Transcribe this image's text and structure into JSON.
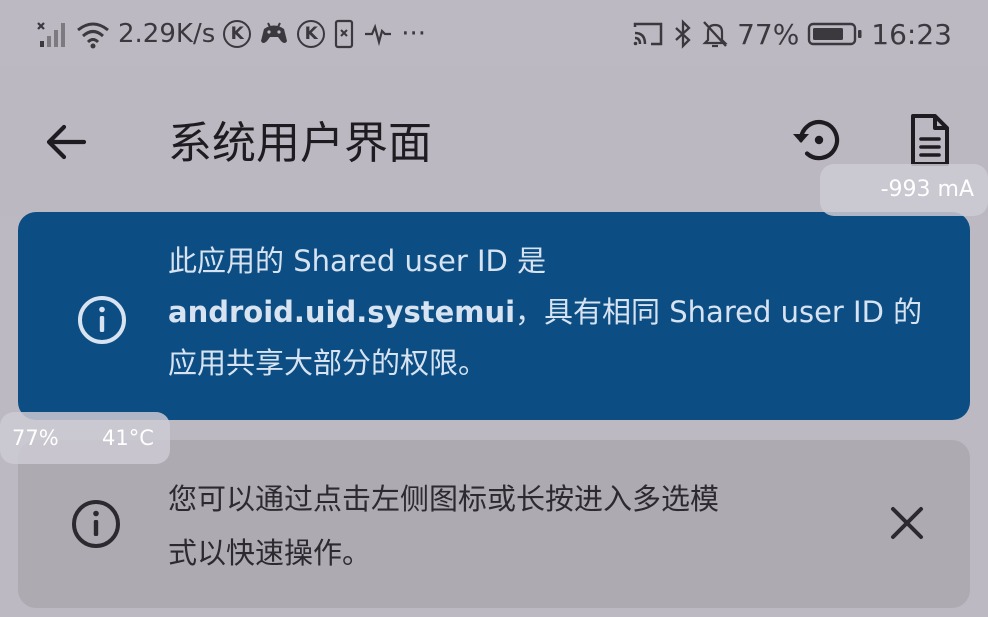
{
  "status_bar": {
    "network_speed": "2.29K/s",
    "k_icon_glyph": "K",
    "more": "···",
    "battery_percent": "77%",
    "time": "16:23"
  },
  "app_bar": {
    "title": "系统用户界面"
  },
  "overlays": {
    "current": "-993 mA",
    "battery": "77%",
    "temperature": "41°C"
  },
  "info_card": {
    "line1": "此应用的 Shared user ID 是",
    "uid": "android.uid.systemui",
    "line2_rest": "，具有相同 Shared user ID 的",
    "line3": "应用共享大部分的权限。"
  },
  "tip_card": {
    "line1": "您可以通过点击左侧图标或长按进入多选模",
    "line2": "式以快速操作。"
  },
  "colors": {
    "background": "#bdb9c3",
    "info_card_bg": "#0c4e84",
    "tip_card_bg": "#adaab2",
    "info_card_text": "#d7e3f1"
  },
  "icons": {
    "back": "arrow-left-icon",
    "restore": "restore-icon",
    "document": "document-icon",
    "info": "info-icon",
    "close": "close-icon"
  }
}
